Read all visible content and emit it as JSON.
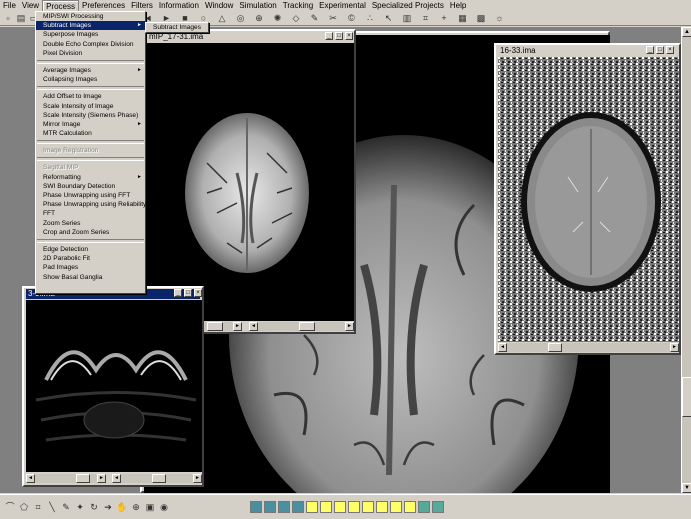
{
  "menubar": [
    "File",
    "View",
    "Process",
    "Preferences",
    "Filters",
    "Information",
    "Window",
    "Simulation",
    "Tracking",
    "Experimental",
    "Specialized Projects",
    "Help"
  ],
  "process_menu": {
    "items": [
      {
        "label": "MIP/SWI Processing",
        "sub": false
      },
      {
        "label": "Subtract Images",
        "sub": true,
        "highlighted": true
      },
      {
        "label": "Superpose Images",
        "sub": false
      },
      {
        "label": "Double Echo Complex Division",
        "sub": false
      },
      {
        "label": "Pixel Division",
        "sub": false
      },
      {
        "sep": true
      },
      {
        "label": "Average Images",
        "sub": true
      },
      {
        "label": "Collapsing Images",
        "sub": false
      },
      {
        "sep": true
      },
      {
        "label": "Add Offset to Image",
        "sub": false
      },
      {
        "label": "Scale Intensity of Image",
        "sub": false
      },
      {
        "label": "Scale Intensity (Siemens Phase)",
        "sub": false
      },
      {
        "label": "Mirror Image",
        "sub": true
      },
      {
        "label": "MTR Calculation",
        "sub": false
      },
      {
        "sep": true
      },
      {
        "label": "Image Registration",
        "sub": false,
        "disabled": true
      },
      {
        "sep": true
      },
      {
        "label": "Sagittal MIP",
        "sub": false,
        "disabled": true
      },
      {
        "label": "Reformatting",
        "sub": true
      },
      {
        "label": "SWI Boundary Detection",
        "sub": false
      },
      {
        "label": "Phase Unwrapping using FFT",
        "sub": false
      },
      {
        "label": "Phase Unwrapping using Reliability",
        "sub": false
      },
      {
        "label": "FFT",
        "sub": false
      },
      {
        "label": "Zoom Series",
        "sub": false
      },
      {
        "label": "Crop and Zoom Series",
        "sub": false
      },
      {
        "sep": true
      },
      {
        "label": "Edge Detection",
        "sub": false
      },
      {
        "label": "2D Parabolic Fit",
        "sub": false
      },
      {
        "label": "Pad Images",
        "sub": false
      },
      {
        "label": "Show Basal Ganglia",
        "sub": false
      }
    ],
    "submenu": [
      "Subtract Images"
    ]
  },
  "windows": {
    "mip": {
      "title": "mIP_17-31.ima"
    },
    "phase": {
      "title": "16-33.ima"
    },
    "breast": {
      "title": "3-9.ima"
    }
  },
  "icons": {
    "toolbar": [
      "new-icon",
      "open-icon",
      "save-icon",
      "print-icon",
      "arrow-left-icon",
      "arrow-right-icon",
      "stop-icon",
      "circle-icon",
      "triangle-icon",
      "circle-dot-icon",
      "crosshair-icon",
      "gear-icon",
      "diamond-icon",
      "pen-icon",
      "tools-icon",
      "copyright-icon",
      "dots-icon",
      "pointer-icon",
      "histogram-icon",
      "crop-icon",
      "plus-icon",
      "table-icon",
      "excel-icon",
      "bulb-icon"
    ],
    "bottom": [
      "lasso-icon",
      "polygon-icon",
      "crop-icon",
      "line-icon",
      "pencil-icon",
      "magic-wand-icon",
      "rotate-icon",
      "arrow-icon",
      "hand-icon",
      "zoom-icon",
      "color-icon",
      "filter-icon"
    ]
  },
  "colors": {
    "menu_highlight": "#0a246a",
    "desktop": "#808080",
    "chrome": "#d4d0c8"
  }
}
